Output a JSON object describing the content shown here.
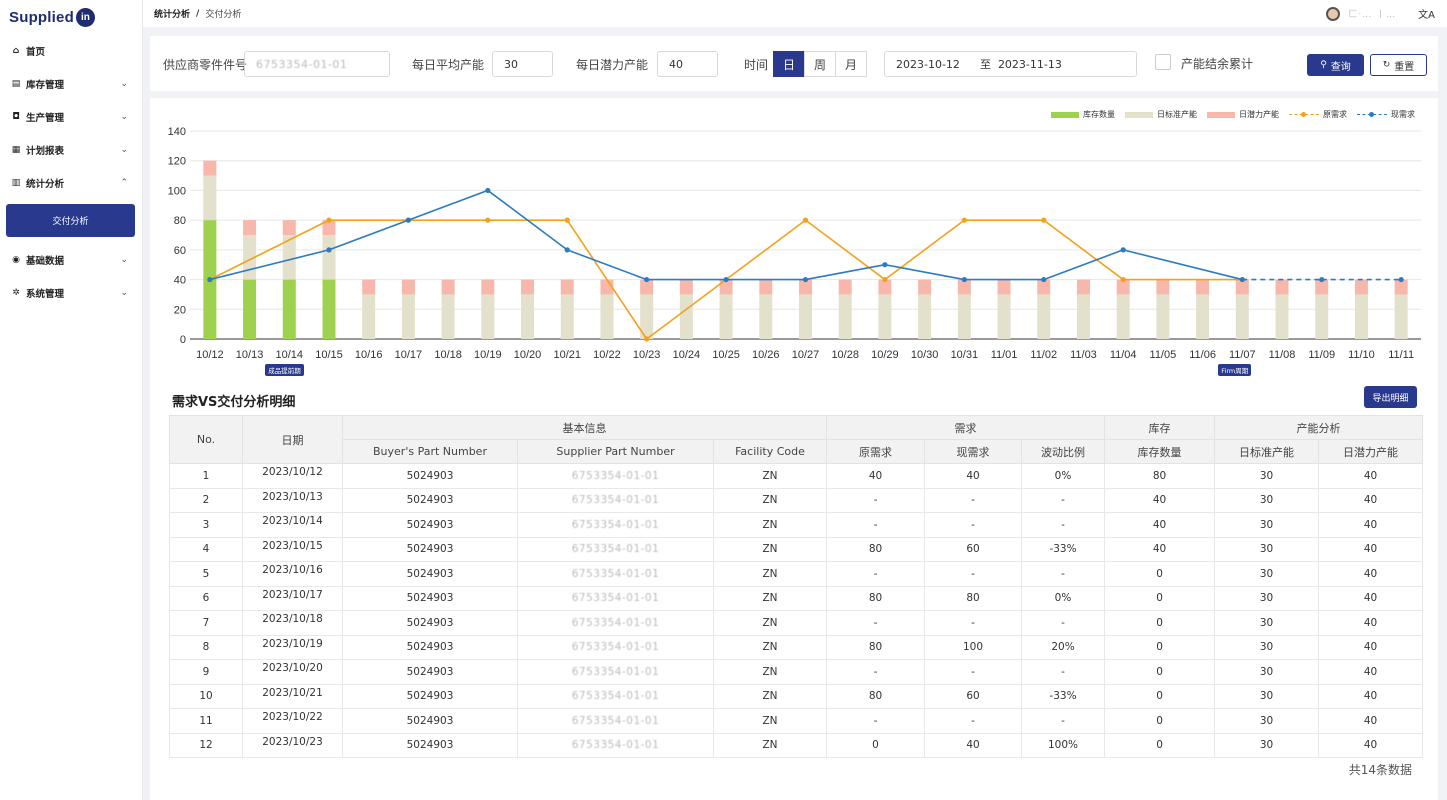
{
  "app": {
    "logo_text": "Supplied",
    "logo_badge": "in"
  },
  "sidebar": {
    "items": [
      {
        "label": "首页",
        "icon": "home-icon",
        "glyph": "⌂"
      },
      {
        "label": "库存管理",
        "icon": "inventory-icon",
        "glyph": "▤",
        "expandable": true
      },
      {
        "label": "生产管理",
        "icon": "production-icon",
        "glyph": "◘",
        "expandable": true
      },
      {
        "label": "计划报表",
        "icon": "report-icon",
        "glyph": "▦",
        "expandable": true
      },
      {
        "label": "统计分析",
        "icon": "stats-icon",
        "glyph": "▥",
        "expandable": true,
        "expanded": true,
        "children": [
          {
            "label": "交付分析",
            "active": true
          }
        ]
      },
      {
        "label": "基础数据",
        "icon": "base-data-icon",
        "glyph": "◉",
        "expandable": true
      },
      {
        "label": "系统管理",
        "icon": "system-gear-icon",
        "glyph": "✲",
        "expandable": true
      }
    ]
  },
  "header": {
    "breadcrumb": [
      "统计分析",
      "交付分析"
    ],
    "separator": "/",
    "user_name": "匚·… 丨…",
    "lang_icon": "translate-icon",
    "lang_glyph": "文A"
  },
  "filter": {
    "supplier_part_label": "供应商零件件号",
    "supplier_part_value": "6753354-01-01",
    "avg_capacity_label": "每日平均产能",
    "avg_capacity_value": "30",
    "potential_capacity_label": "每日潜力产能",
    "potential_capacity_value": "40",
    "time_label": "时间",
    "time_options": [
      "日",
      "周",
      "月"
    ],
    "time_selected": "日",
    "date_from": "2023-10-12",
    "date_to_label": "至",
    "date_to": "2023-11-13",
    "cumulative_label": "产能结余累计",
    "cumulative_checked": false,
    "query_button": "查询",
    "reset_button": "重置"
  },
  "chart_data": {
    "type": "bar",
    "categories": [
      "10/12",
      "10/13",
      "10/14",
      "10/15",
      "10/16",
      "10/17",
      "10/18",
      "10/19",
      "10/20",
      "10/21",
      "10/22",
      "10/23",
      "10/24",
      "10/25",
      "10/26",
      "10/27",
      "10/28",
      "10/29",
      "10/30",
      "10/31",
      "11/01",
      "11/02",
      "11/03",
      "11/04",
      "11/05",
      "11/06",
      "11/07",
      "11/08",
      "11/09",
      "11/10",
      "11/11"
    ],
    "ylim": [
      0,
      140
    ],
    "yticks": [
      0,
      20,
      40,
      60,
      80,
      100,
      120,
      140
    ],
    "grid": true,
    "legend_position": "top-right",
    "stacked_bars": [
      {
        "name": "库存数量",
        "color": "#9ed14e",
        "values": [
          80,
          40,
          40,
          40,
          0,
          0,
          0,
          0,
          0,
          0,
          0,
          0,
          0,
          0,
          0,
          0,
          0,
          0,
          0,
          0,
          0,
          0,
          0,
          0,
          0,
          0,
          0,
          0,
          0,
          0,
          0
        ]
      },
      {
        "name": "日标准产能",
        "color": "#e3e0cc",
        "values": [
          30,
          30,
          30,
          30,
          30,
          30,
          30,
          30,
          30,
          30,
          30,
          30,
          30,
          30,
          30,
          30,
          30,
          30,
          30,
          30,
          30,
          30,
          30,
          30,
          30,
          30,
          30,
          30,
          30,
          30,
          30
        ]
      },
      {
        "name": "日潜力产能",
        "color": "#f7b7ab",
        "values": [
          10,
          10,
          10,
          10,
          10,
          10,
          10,
          10,
          10,
          10,
          10,
          10,
          10,
          10,
          10,
          10,
          10,
          10,
          10,
          10,
          10,
          10,
          10,
          10,
          10,
          10,
          10,
          10,
          10,
          10,
          10
        ]
      }
    ],
    "lines": [
      {
        "name": "原需求",
        "color": "#f5a01a",
        "values": [
          40,
          null,
          null,
          80,
          null,
          80,
          null,
          80,
          null,
          80,
          null,
          0,
          null,
          null,
          null,
          80,
          null,
          40,
          null,
          80,
          null,
          80,
          null,
          40,
          null,
          null,
          40,
          null,
          null,
          null,
          null
        ]
      },
      {
        "name": "现需求",
        "color": "#2b7bc2",
        "values": [
          40,
          null,
          null,
          60,
          null,
          80,
          null,
          100,
          null,
          60,
          null,
          40,
          null,
          40,
          null,
          40,
          null,
          50,
          null,
          40,
          null,
          40,
          null,
          60,
          null,
          null,
          40,
          null,
          40,
          null,
          40
        ],
        "dashed_from_index": 26
      }
    ],
    "markers": [
      {
        "category": "10/14",
        "label": "成品提前期"
      },
      {
        "category": "11/07",
        "label": "Firm周期"
      }
    ]
  },
  "detail": {
    "title": "需求VS交付分析明细",
    "export_button": "导出明细",
    "group_headers": [
      "No.",
      "日期",
      "基本信息",
      "需求",
      "库存",
      "产能分析"
    ],
    "columns": [
      "Buyer's Part Number",
      "Supplier Part Number",
      "Facility Code",
      "原需求",
      "现需求",
      "波动比例",
      "库存数量",
      "日标准产能",
      "日潜力产能"
    ],
    "rows": [
      [
        "1",
        "2023/10/12",
        "5024903",
        "6753354-01-01",
        "ZN",
        "40",
        "40",
        "0%",
        "80",
        "30",
        "40"
      ],
      [
        "2",
        "2023/10/13",
        "5024903",
        "6753354-01-01",
        "ZN",
        "-",
        "-",
        "-",
        "40",
        "30",
        "40"
      ],
      [
        "3",
        "2023/10/14",
        "5024903",
        "6753354-01-01",
        "ZN",
        "-",
        "-",
        "-",
        "40",
        "30",
        "40"
      ],
      [
        "4",
        "2023/10/15",
        "5024903",
        "6753354-01-01",
        "ZN",
        "80",
        "60",
        "-33%",
        "40",
        "30",
        "40"
      ],
      [
        "5",
        "2023/10/16",
        "5024903",
        "6753354-01-01",
        "ZN",
        "-",
        "-",
        "-",
        "0",
        "30",
        "40"
      ],
      [
        "6",
        "2023/10/17",
        "5024903",
        "6753354-01-01",
        "ZN",
        "80",
        "80",
        "0%",
        "0",
        "30",
        "40"
      ],
      [
        "7",
        "2023/10/18",
        "5024903",
        "6753354-01-01",
        "ZN",
        "-",
        "-",
        "-",
        "0",
        "30",
        "40"
      ],
      [
        "8",
        "2023/10/19",
        "5024903",
        "6753354-01-01",
        "ZN",
        "80",
        "100",
        "20%",
        "0",
        "30",
        "40"
      ],
      [
        "9",
        "2023/10/20",
        "5024903",
        "6753354-01-01",
        "ZN",
        "-",
        "-",
        "-",
        "0",
        "30",
        "40"
      ],
      [
        "10",
        "2023/10/21",
        "5024903",
        "6753354-01-01",
        "ZN",
        "80",
        "60",
        "-33%",
        "0",
        "30",
        "40"
      ],
      [
        "11",
        "2023/10/22",
        "5024903",
        "6753354-01-01",
        "ZN",
        "-",
        "-",
        "-",
        "0",
        "30",
        "40"
      ],
      [
        "12",
        "2023/10/23",
        "5024903",
        "6753354-01-01",
        "ZN",
        "0",
        "40",
        "100%",
        "0",
        "30",
        "40"
      ]
    ],
    "total_text": "共14条数据"
  }
}
